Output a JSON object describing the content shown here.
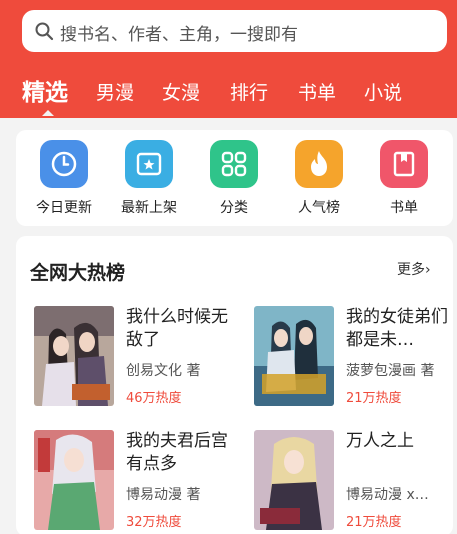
{
  "search": {
    "placeholder": "搜书名、作者、主角，一搜即有"
  },
  "tabs": [
    {
      "label": "精选",
      "active": true
    },
    {
      "label": "男漫",
      "active": false
    },
    {
      "label": "女漫",
      "active": false
    },
    {
      "label": "排行",
      "active": false
    },
    {
      "label": "书单",
      "active": false
    },
    {
      "label": "小说",
      "active": false
    }
  ],
  "quick_nav": [
    {
      "label": "今日更新",
      "icon": "clock-icon",
      "color": "#4a90e8"
    },
    {
      "label": "最新上架",
      "icon": "star-box-icon",
      "color": "#3aaee3"
    },
    {
      "label": "分类",
      "icon": "grid-icon",
      "color": "#2fc48a"
    },
    {
      "label": "人气榜",
      "icon": "flame-icon",
      "color": "#f5a42c"
    },
    {
      "label": "书单",
      "icon": "bookmark-icon",
      "color": "#f0566a"
    }
  ],
  "hot_list": {
    "title": "全网大热榜",
    "more": "更多",
    "books": [
      {
        "title": "我什么时候无敌了",
        "author": "创易文化 著",
        "heat": "46万热度"
      },
      {
        "title": "我的女徒弟们都是未…",
        "author": "菠萝包漫画 著",
        "heat": "21万热度"
      },
      {
        "title": "我的夫君后宫有点多",
        "author": "博易动漫 著",
        "heat": "32万热度"
      },
      {
        "title": "万人之上",
        "author": "博易动漫 x…",
        "heat": "21万热度"
      }
    ]
  },
  "colors": {
    "accent": "#ef4b3c",
    "background": "#f3f3f3"
  }
}
